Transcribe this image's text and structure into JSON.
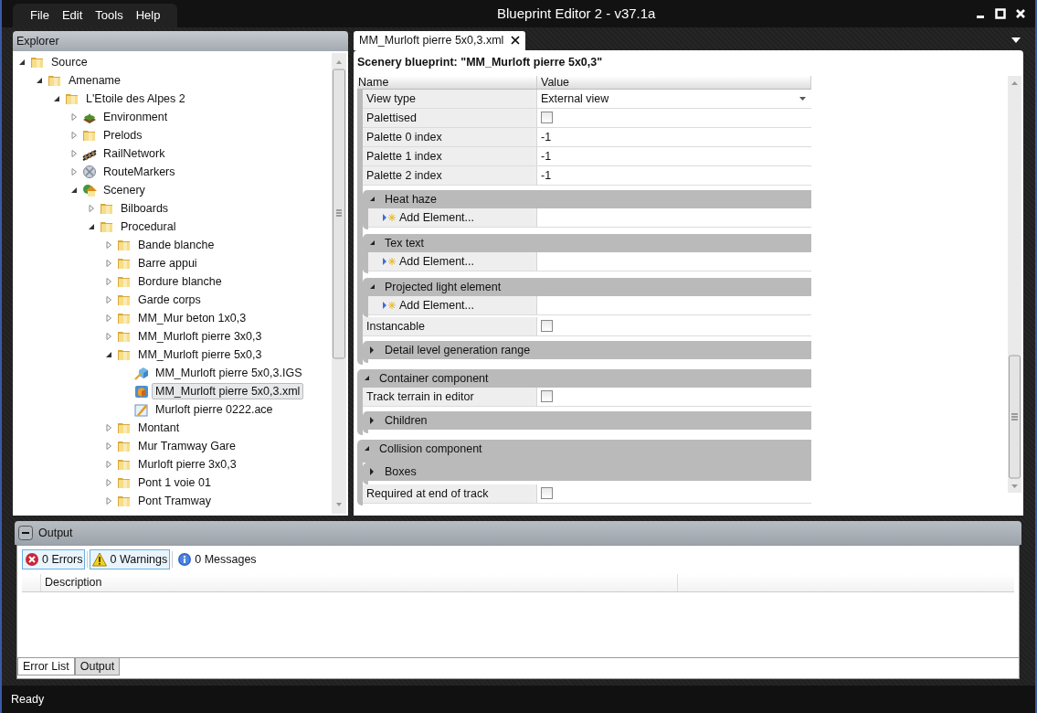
{
  "window": {
    "title": "Blueprint Editor 2 - v37.1a"
  },
  "menu": [
    "File",
    "Edit",
    "Tools",
    "Help"
  ],
  "explorer": {
    "title": "Explorer",
    "tree": [
      {
        "label": "Source",
        "kind": "folder",
        "expanded": true,
        "selected": false,
        "children": [
          {
            "label": "Amename",
            "kind": "folder",
            "expanded": true,
            "selected": false,
            "children": [
              {
                "label": "L'Etoile des Alpes 2",
                "kind": "folder",
                "expanded": true,
                "selected": false,
                "children": [
                  {
                    "label": "Environment",
                    "kind": "environment",
                    "expanded": false,
                    "selected": false
                  },
                  {
                    "label": "Prelods",
                    "kind": "folder",
                    "expanded": false,
                    "selected": false
                  },
                  {
                    "label": "RailNetwork",
                    "kind": "rail",
                    "expanded": false,
                    "selected": false
                  },
                  {
                    "label": "RouteMarkers",
                    "kind": "marker",
                    "expanded": false,
                    "selected": false
                  },
                  {
                    "label": "Scenery",
                    "kind": "scenery",
                    "expanded": true,
                    "selected": false,
                    "children": [
                      {
                        "label": "Bilboards",
                        "kind": "folder",
                        "expanded": false,
                        "selected": false
                      },
                      {
                        "label": "Procedural",
                        "kind": "folder",
                        "expanded": true,
                        "selected": false,
                        "children": [
                          {
                            "label": "Bande blanche",
                            "kind": "folder",
                            "expanded": false,
                            "selected": false
                          },
                          {
                            "label": "Barre appui",
                            "kind": "folder",
                            "expanded": false,
                            "selected": false
                          },
                          {
                            "label": "Bordure blanche",
                            "kind": "folder",
                            "expanded": false,
                            "selected": false
                          },
                          {
                            "label": "Garde corps",
                            "kind": "folder",
                            "expanded": false,
                            "selected": false
                          },
                          {
                            "label": "MM_Mur beton 1x0,3",
                            "kind": "folder",
                            "expanded": false,
                            "selected": false
                          },
                          {
                            "label": "MM_Murloft pierre 3x0,3",
                            "kind": "folder",
                            "expanded": false,
                            "selected": false
                          },
                          {
                            "label": "MM_Murloft pierre 5x0,3",
                            "kind": "folder",
                            "expanded": true,
                            "selected": false,
                            "children": [
                              {
                                "label": "MM_Murloft pierre 5x0,3.IGS",
                                "kind": "model",
                                "selected": false
                              },
                              {
                                "label": "MM_Murloft pierre 5x0,3.xml",
                                "kind": "blueprint",
                                "selected": true
                              },
                              {
                                "label": "Murloft pierre 0222.ace",
                                "kind": "texture",
                                "selected": false
                              }
                            ]
                          },
                          {
                            "label": "Montant",
                            "kind": "folder",
                            "expanded": false,
                            "selected": false
                          },
                          {
                            "label": "Mur Tramway Gare",
                            "kind": "folder",
                            "expanded": false,
                            "selected": false
                          },
                          {
                            "label": "Murloft pierre 3x0,3",
                            "kind": "folder",
                            "expanded": false,
                            "selected": false
                          },
                          {
                            "label": "Pont 1 voie 01",
                            "kind": "folder",
                            "expanded": false,
                            "selected": false
                          },
                          {
                            "label": "Pont Tramway",
                            "kind": "folder",
                            "expanded": false,
                            "selected": false
                          }
                        ]
                      }
                    ]
                  }
                ]
              }
            ]
          }
        ]
      }
    ]
  },
  "editor": {
    "tab": {
      "label": "MM_Murloft pierre 5x0,3.xml",
      "selected": true
    },
    "heading": "Scenery blueprint: \"MM_Murloft pierre 5x0,3\"",
    "columns": [
      "Name",
      "Value"
    ],
    "rows": [
      {
        "kind": "section",
        "children": [
          {
            "kind": "dropdown",
            "name": "View type",
            "value": "External view"
          },
          {
            "kind": "checkbox",
            "name": "Palettised",
            "checked": false
          },
          {
            "kind": "property",
            "name": "Palette 0 index",
            "value": "-1"
          },
          {
            "kind": "property",
            "name": "Palette 1 index",
            "value": "-1"
          },
          {
            "kind": "property",
            "name": "Palette 2 index",
            "value": "-1"
          },
          {
            "kind": "group",
            "title": "Heat haze",
            "expanded": true,
            "children": [
              {
                "kind": "add",
                "label": "Add Element..."
              }
            ]
          },
          {
            "kind": "group",
            "title": "Tex text",
            "expanded": true,
            "children": [
              {
                "kind": "add",
                "label": "Add Element..."
              }
            ]
          },
          {
            "kind": "group",
            "title": "Projected light element",
            "expanded": true,
            "children": [
              {
                "kind": "add",
                "label": "Add Element..."
              }
            ]
          },
          {
            "kind": "checkbox",
            "name": "Instancable",
            "checked": false
          },
          {
            "kind": "group",
            "title": "Detail level generation range",
            "expanded": false
          }
        ]
      },
      {
        "kind": "group",
        "title": "Container component",
        "expanded": true,
        "children": [
          {
            "kind": "checkbox",
            "name": "Track terrain in editor",
            "checked": false
          },
          {
            "kind": "group",
            "title": "Children",
            "expanded": false
          }
        ]
      },
      {
        "kind": "group",
        "title": "Collision component",
        "expanded": true,
        "children": [
          {
            "kind": "group",
            "title": "Boxes",
            "expanded": false
          },
          {
            "kind": "checkbox",
            "name": "Required at end of track",
            "checked": false
          }
        ]
      }
    ]
  },
  "output": {
    "title": "Output",
    "filters": [
      {
        "kind": "error",
        "label": "0 Errors",
        "selected": true
      },
      {
        "kind": "warning",
        "label": "0 Warnings",
        "selected": true
      },
      {
        "kind": "info",
        "label": "0 Messages",
        "selected": false
      }
    ],
    "columns": [
      "Description"
    ],
    "tabs": [
      {
        "label": "Error List",
        "selected": true
      },
      {
        "label": "Output",
        "selected": false
      }
    ]
  },
  "status_bar": "Ready"
}
